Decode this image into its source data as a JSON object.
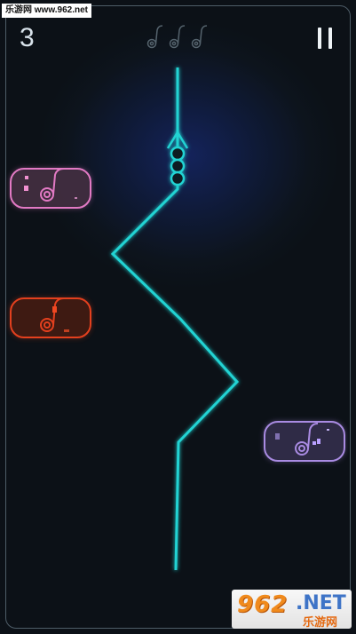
{
  "watermark_top": "乐游网 www.962.net",
  "hud": {
    "score": "3",
    "notes_icon": "music-note-icon",
    "pause_icon": "pause-icon"
  },
  "logo": {
    "number": "962",
    "net": ".NET",
    "cn": "乐游网"
  },
  "colors": {
    "path": "#20d3d3",
    "pink": "#e27ac4",
    "red": "#e3401e",
    "purple": "#a98be2"
  },
  "game": {
    "obstacles": [
      {
        "color_key": "pink",
        "icon": "music-note-icon"
      },
      {
        "color_key": "red",
        "icon": "music-note-icon"
      },
      {
        "color_key": "purple",
        "icon": "music-note-icon"
      }
    ]
  }
}
